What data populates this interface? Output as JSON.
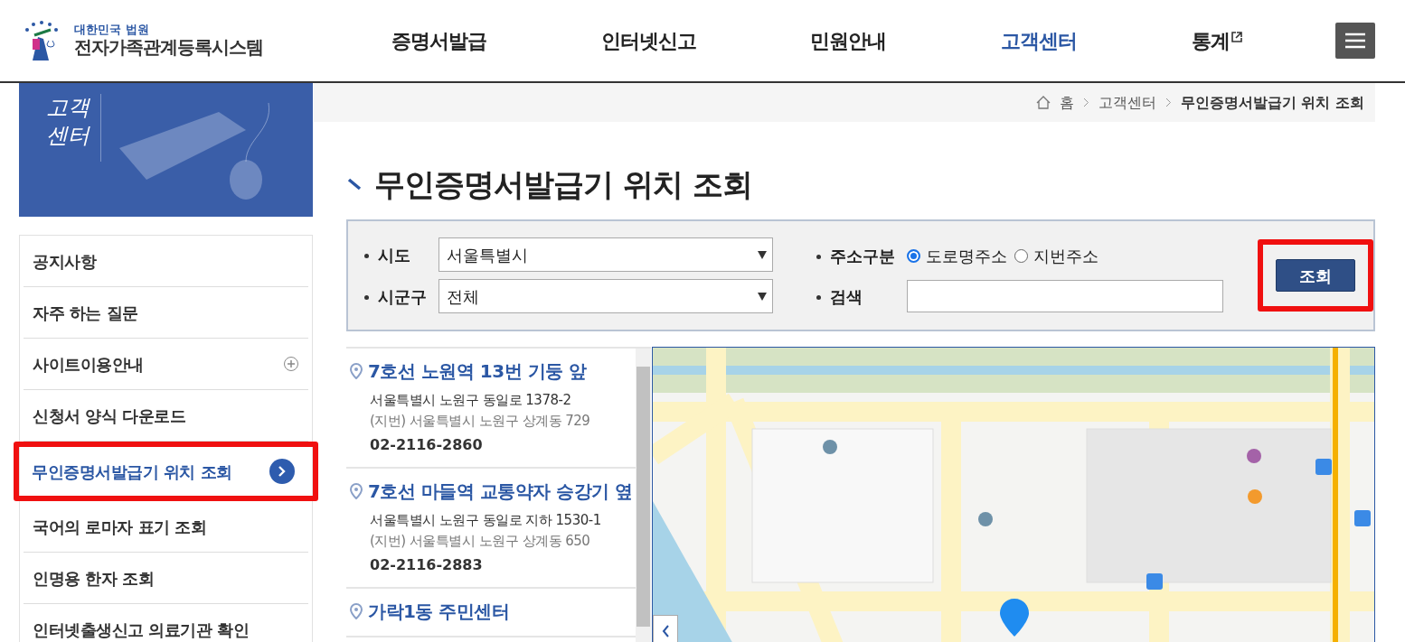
{
  "logo": {
    "subtitle": "대한민국 법원",
    "title": "전자가족관계등록시스템"
  },
  "nav": [
    {
      "label": "증명서발급",
      "selected": false,
      "external": false
    },
    {
      "label": "인터넷신고",
      "selected": false,
      "external": false
    },
    {
      "label": "민원안내",
      "selected": false,
      "external": false
    },
    {
      "label": "고객센터",
      "selected": true,
      "external": false
    },
    {
      "label": "통계",
      "selected": false,
      "external": true
    }
  ],
  "banner": {
    "line1": "고객",
    "line2": "센터"
  },
  "sidebar": {
    "items": [
      {
        "label": "공지사항",
        "selected": false,
        "expandable": false
      },
      {
        "label": "자주 하는 질문",
        "selected": false,
        "expandable": false
      },
      {
        "label": "사이트이용안내",
        "selected": false,
        "expandable": true
      },
      {
        "label": "신청서 양식 다운로드",
        "selected": false,
        "expandable": false
      },
      {
        "label": "무인증명서발급기 위치 조회",
        "selected": true,
        "expandable": false
      },
      {
        "label": "국어의 로마자 표기 조회",
        "selected": false,
        "expandable": false
      },
      {
        "label": "인명용 한자 조회",
        "selected": false,
        "expandable": false
      },
      {
        "label": "인터넷출생신고 의료기관 확인",
        "selected": false,
        "expandable": false
      }
    ]
  },
  "breadcrumb": [
    "홈",
    "고객센터",
    "무인증명서발급기 위치 조회"
  ],
  "page_title": "무인증명서발급기 위치 조회",
  "search": {
    "sido_label": "시도",
    "sido_value": "서울특별시",
    "sigungu_label": "시군구",
    "sigungu_value": "전체",
    "address_type_label": "주소구분",
    "address_types": [
      {
        "label": "도로명주소",
        "selected": true
      },
      {
        "label": "지번주소",
        "selected": false
      }
    ],
    "keyword_label": "검색",
    "button": "조회"
  },
  "results": [
    {
      "name": "7호선 노원역 13번 기둥 앞",
      "road_address": "서울특별시 노원구 동일로 1378-2",
      "lot_address": "(지번) 서울특별시 노원구 상계동 729",
      "phone": "02-2116-2860"
    },
    {
      "name": "7호선 마들역 교통약자 승강기 옆",
      "road_address": "서울특별시 노원구 동일로 지하 1530-1",
      "lot_address": "(지번) 서울특별시 노원구 상계동 650",
      "phone": "02-2116-2883"
    },
    {
      "name": "가락1동 주민센터"
    }
  ]
}
